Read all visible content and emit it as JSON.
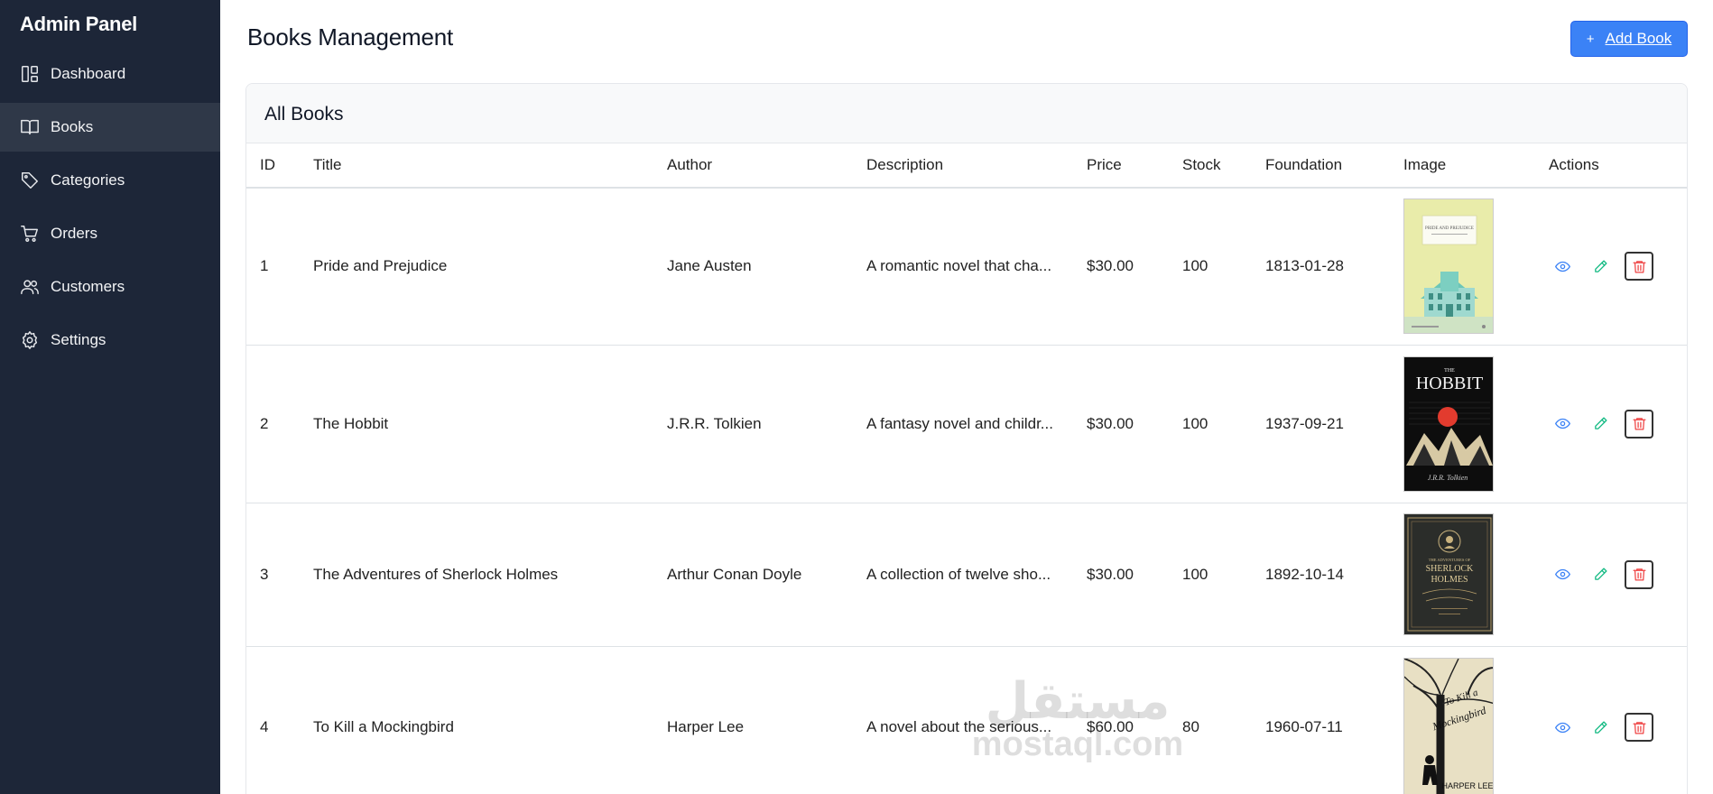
{
  "sidebar": {
    "brand": "Admin Panel",
    "items": [
      {
        "label": "Dashboard",
        "icon": "dashboard-icon",
        "active": false
      },
      {
        "label": "Books",
        "icon": "book-icon",
        "active": true
      },
      {
        "label": "Categories",
        "icon": "tag-icon",
        "active": false
      },
      {
        "label": "Orders",
        "icon": "cart-icon",
        "active": false
      },
      {
        "label": "Customers",
        "icon": "users-icon",
        "active": false
      },
      {
        "label": "Settings",
        "icon": "gear-icon",
        "active": false
      }
    ]
  },
  "header": {
    "title": "Books Management",
    "add_button_icon": "+",
    "add_button_label": "Add Book"
  },
  "card": {
    "title": "All Books"
  },
  "table": {
    "columns": [
      "ID",
      "Title",
      "Author",
      "Description",
      "Price",
      "Stock",
      "Foundation",
      "Image",
      "Actions"
    ],
    "rows": [
      {
        "id": "1",
        "title": "Pride and Prejudice",
        "author": "Jane Austen",
        "description": "A romantic novel that cha...",
        "price": "$30.00",
        "stock": "100",
        "foundation": "1813-01-28",
        "cover": "pride-and-prejudice-cover"
      },
      {
        "id": "2",
        "title": "The Hobbit",
        "author": "J.R.R. Tolkien",
        "description": "A fantasy novel and childr...",
        "price": "$30.00",
        "stock": "100",
        "foundation": "1937-09-21",
        "cover": "the-hobbit-cover"
      },
      {
        "id": "3",
        "title": "The Adventures of Sherlock Holmes",
        "author": "Arthur Conan Doyle",
        "description": "A collection of twelve sho...",
        "price": "$30.00",
        "stock": "100",
        "foundation": "1892-10-14",
        "cover": "sherlock-holmes-cover"
      },
      {
        "id": "4",
        "title": "To Kill a Mockingbird",
        "author": "Harper Lee",
        "description": "A novel about the serious...",
        "price": "$60.00",
        "stock": "80",
        "foundation": "1960-07-11",
        "cover": "to-kill-a-mockingbird-cover"
      }
    ]
  },
  "covers": {
    "pp_title": "PRIDE AND PREJUDICE",
    "hobbit_the": "THE",
    "hobbit_title": "HOBBIT",
    "hobbit_sig": "J.R.R. Tolkien",
    "sh_line1": "THE ADVENTURES OF",
    "sh_line2": "SHERLOCK",
    "sh_line3": "HOLMES",
    "mb_line1": "To Kill a",
    "mb_line2": "Mockingbird",
    "mb_author": "HARPER LEE"
  },
  "watermark": {
    "arabic": "مستقل",
    "latin": "mostaql.com"
  },
  "colors": {
    "sidebar_bg": "#1d2638",
    "sidebar_active": "#2f3848",
    "primary": "#3b82f6",
    "view": "#3b82f6",
    "edit": "#10b981",
    "delete": "#ef4444"
  }
}
